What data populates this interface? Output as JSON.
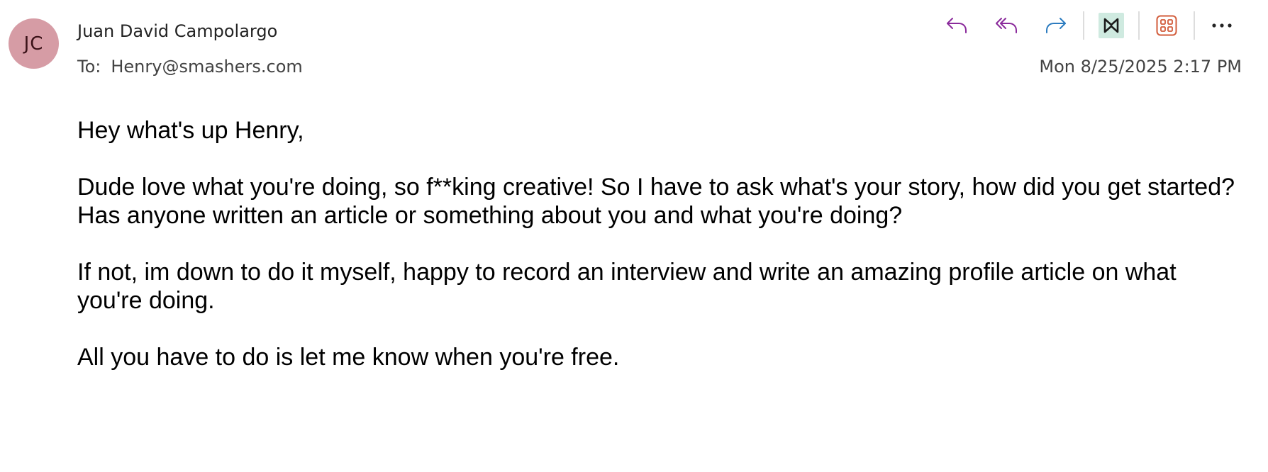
{
  "email": {
    "avatar_initials": "JC",
    "sender_name": "Juan David Campolargo",
    "to_label": "To:",
    "to_address": "Henry@smashers.com",
    "timestamp": "Mon 8/25/2025 2:17 PM",
    "body": {
      "greeting": "Hey what's up Henry,",
      "paragraph1": "Dude love what you're doing, so f**king creative! So I have to ask what's your story, how did you get started? Has anyone written an article or something about you and what you're doing?",
      "paragraph2": "If not, im down to do it myself, happy to record an interview and write an amazing profile article on what you're doing.",
      "paragraph3": "All you have to do is let me know when you're free."
    }
  },
  "toolbar": {
    "actions": [
      {
        "name": "reply",
        "icon": "reply-icon",
        "color": "#8a2a9b"
      },
      {
        "name": "reply-all",
        "icon": "reply-all-icon",
        "color": "#8a2a9b"
      },
      {
        "name": "forward",
        "icon": "forward-icon",
        "color": "#2b7bbf"
      },
      {
        "name": "addin",
        "icon": "bowtie-app-icon",
        "color": "#1f6f5a"
      },
      {
        "name": "apps",
        "icon": "apps-grid-icon",
        "color": "#d25b3a"
      },
      {
        "name": "more",
        "icon": "more-icon",
        "color": "#242424"
      }
    ]
  },
  "colors": {
    "avatar_bg": "#d69ca5",
    "reply_purple": "#8a2a9b",
    "forward_blue": "#2b7bbf",
    "addin_bg": "#cfeae0",
    "apps_orange": "#d25b3a"
  }
}
